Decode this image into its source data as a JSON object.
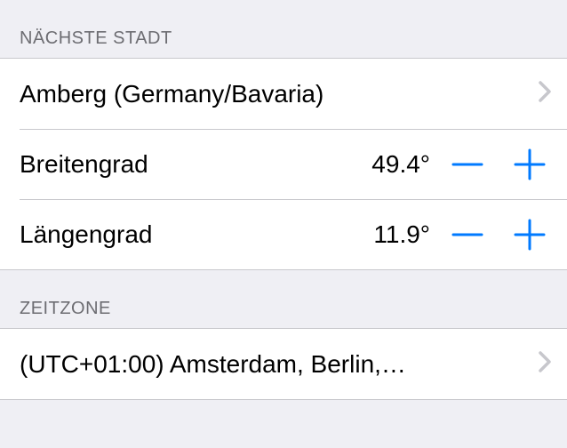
{
  "sections": {
    "nearestCity": {
      "header": "NÄCHSTE STADT",
      "cityRow": {
        "label": "Amberg (Germany/Bavaria)"
      },
      "latitudeRow": {
        "label": "Breitengrad",
        "value": "49.4°"
      },
      "longitudeRow": {
        "label": "Längengrad",
        "value": "11.9°"
      }
    },
    "timezone": {
      "header": "ZEITZONE",
      "row": {
        "label": "(UTC+01:00) Amsterdam, Berlin,…"
      }
    }
  }
}
